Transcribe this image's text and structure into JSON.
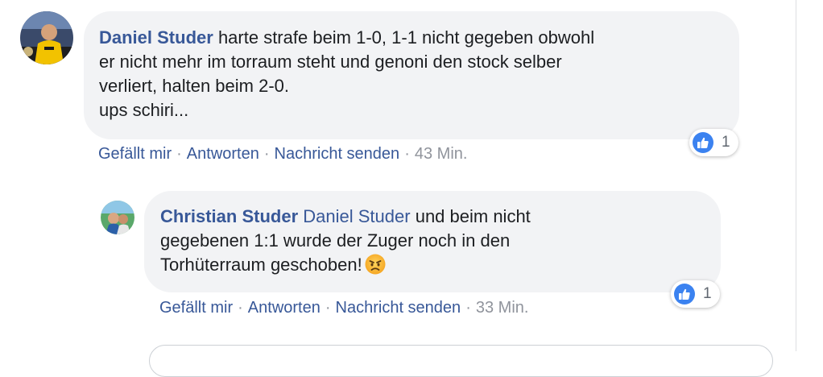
{
  "comments": [
    {
      "author": "Daniel Studer",
      "lines": [
        "harte strafe beim 1-0, 1-1 nicht gegeben obwohl",
        "er nicht mehr im torraum steht und genoni den stock selber",
        "verliert, halten beim 2-0.",
        "ups schiri..."
      ],
      "actions": {
        "like": "Gefällt mir",
        "reply": "Antworten",
        "message": "Nachricht senden",
        "separator": "·",
        "time": "43 Min."
      },
      "reactions": {
        "icon": "thumbs-up-icon",
        "count": "1"
      }
    },
    {
      "author": "Christian Studer",
      "mention": "Daniel Studer",
      "line1_rest": "und beim nicht",
      "line2": "gegebenen 1:1 wurde der Zuger noch in den",
      "line3": "Torhüterraum geschoben!",
      "emoji": "angry-face-emoji",
      "actions": {
        "like": "Gefällt mir",
        "reply": "Antworten",
        "message": "Nachricht senden",
        "separator": "·",
        "time": "33 Min."
      },
      "reactions": {
        "icon": "thumbs-up-icon",
        "count": "1"
      }
    }
  ],
  "composer": {
    "placeholder": ""
  },
  "colors": {
    "link": "#385898",
    "bubble": "#f2f3f5",
    "text": "#1c1e21",
    "meta": "#90949c",
    "like": "#3b82f0"
  }
}
